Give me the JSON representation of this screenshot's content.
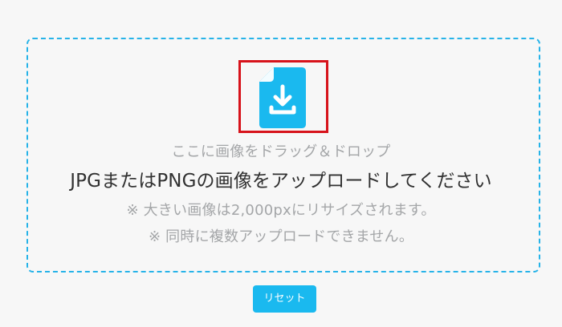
{
  "dropzone": {
    "icon": "file-download-icon",
    "accent_color": "#27b3e8",
    "icon_color": "#1ab9ef",
    "highlight_color": "#d7131b",
    "drop_instruction": "ここに画像をドラッグ＆ドロップ",
    "main_instruction": "JPGまたはPNGの画像をアップロードしてください",
    "note_resize": "※ 大きい画像は2,000pxにリサイズされます。",
    "note_single": "※ 同時に複数アップロードできません。"
  },
  "actions": {
    "reset_label": "リセット"
  }
}
